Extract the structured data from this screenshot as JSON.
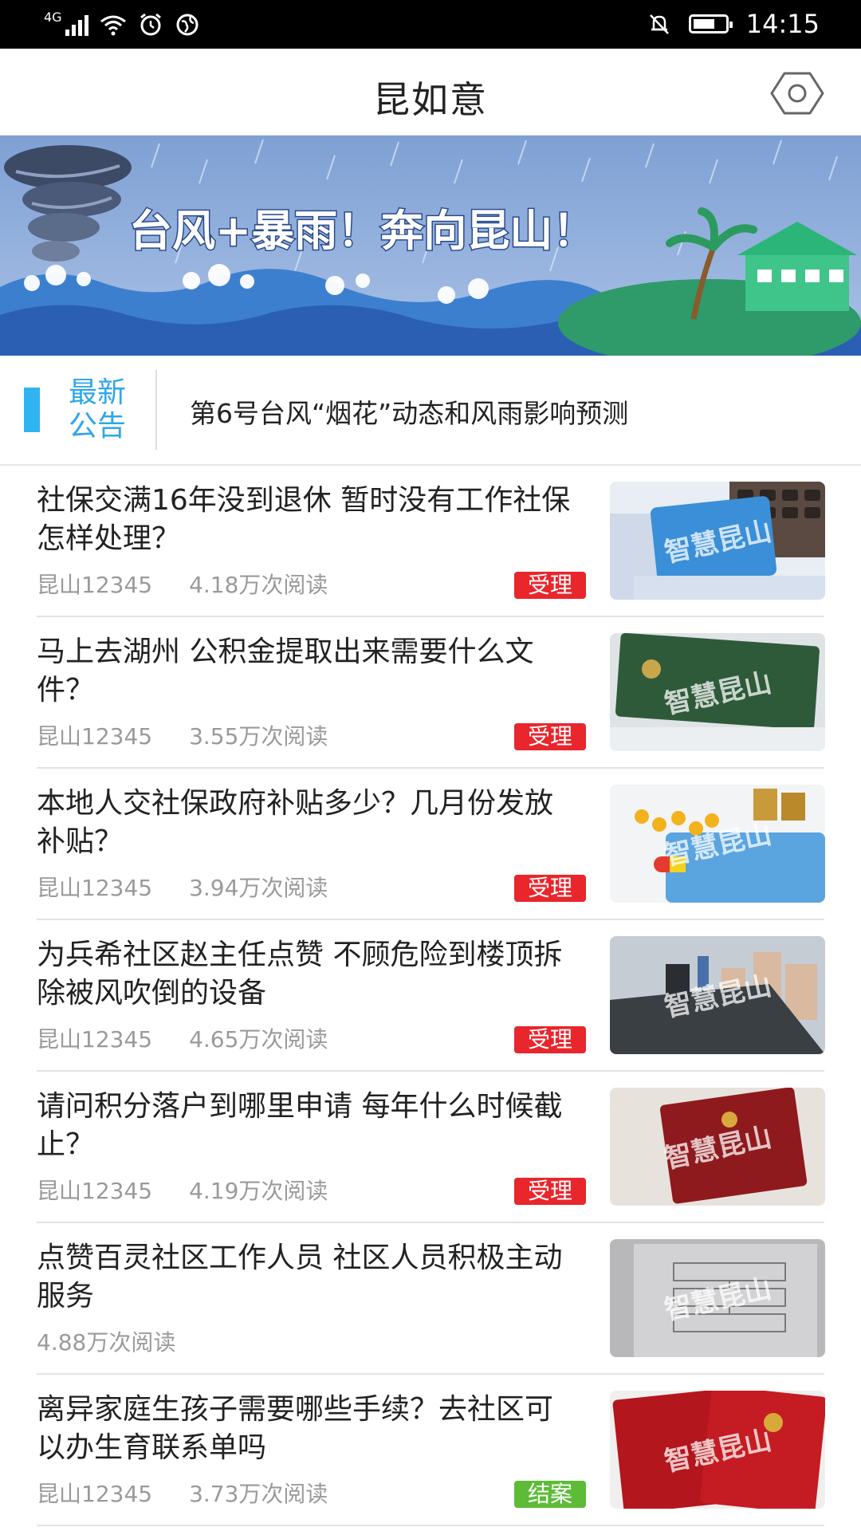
{
  "status_bar": {
    "network": "4G",
    "time": "14:15"
  },
  "header": {
    "title": "昆如意"
  },
  "banner": {
    "headline": "台风+暴雨！奔向昆山！"
  },
  "notice": {
    "tag_line1": "最新",
    "tag_line2": "公告",
    "text": "第6号台风“烟花”动态和风雨影响预测"
  },
  "colors": {
    "accent": "#2fb4f0",
    "badge_accepted": "#e8262c",
    "badge_closed": "#5dbb38"
  },
  "news": [
    {
      "title": "社保交满16年没到退休 暂时没有工作社保怎样处理？",
      "source": "昆山12345",
      "reads": "4.18万次阅读",
      "badge": "受理",
      "thumb_watermark": "智慧昆山"
    },
    {
      "title": "马上去湖州 公积金提取出来需要什么文件？",
      "source": "昆山12345",
      "reads": "3.55万次阅读",
      "badge": "受理",
      "thumb_watermark": "智慧昆山"
    },
    {
      "title": "本地人交社保政府补贴多少？几月份发放补贴？",
      "source": "昆山12345",
      "reads": "3.94万次阅读",
      "badge": "受理",
      "thumb_watermark": "智慧昆山"
    },
    {
      "title": "为兵希社区赵主任点赞 不顾危险到楼顶拆除被风吹倒的设备",
      "source": "昆山12345",
      "reads": "4.65万次阅读",
      "badge": "受理",
      "thumb_watermark": "智慧昆山"
    },
    {
      "title": "请问积分落户到哪里申请 每年什么时候截止？",
      "source": "昆山12345",
      "reads": "4.19万次阅读",
      "badge": "受理",
      "thumb_watermark": "智慧昆山"
    },
    {
      "title": "点赞百灵社区工作人员 社区人员积极主动服务",
      "source": "",
      "reads": "4.88万次阅读",
      "badge": "",
      "thumb_watermark": "智慧昆山"
    },
    {
      "title": "离异家庭生孩子需要哪些手续？去社区可以办生育联系单吗",
      "source": "昆山12345",
      "reads": "3.73万次阅读",
      "badge": "结案",
      "thumb_watermark": "智慧昆山"
    }
  ]
}
